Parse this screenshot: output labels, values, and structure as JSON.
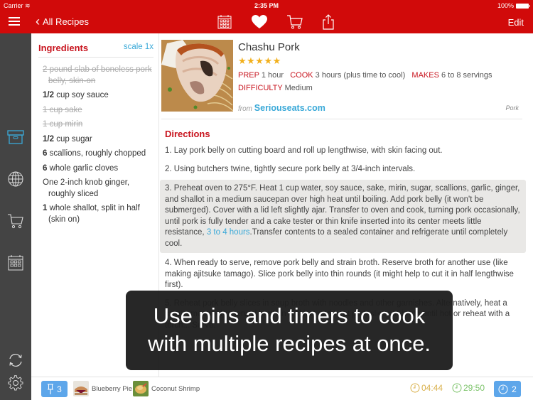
{
  "status_bar": {
    "carrier": "Carrier",
    "time": "2:35 PM",
    "battery": "100%"
  },
  "nav": {
    "back_label": "All Recipes",
    "edit_label": "Edit"
  },
  "ingredients": {
    "title": "Ingredients",
    "scale_label": "scale 1x",
    "items": [
      {
        "qty": "2",
        "text": " pound slab of boneless pork belly, skin-on",
        "done": true
      },
      {
        "qty": "1/2",
        "text": " cup soy sauce",
        "done": false
      },
      {
        "qty": "1",
        "text": " cup sake",
        "done": true
      },
      {
        "qty": "1",
        "text": " cup mirin",
        "done": true
      },
      {
        "qty": "1/2",
        "text": " cup sugar",
        "done": false
      },
      {
        "qty": "6",
        "text": " scallions, roughly chopped",
        "done": false
      },
      {
        "qty": "6",
        "text": " whole garlic cloves",
        "done": false
      },
      {
        "qty": "",
        "text": "One 2-inch knob ginger, roughly sliced",
        "done": false
      },
      {
        "qty": "1",
        "text": " whole shallot, split in half (skin on)",
        "done": false
      }
    ]
  },
  "recipe": {
    "title": "Chashu Pork",
    "rating": 5,
    "stars": "★★★★★",
    "prep_label": "PREP",
    "prep_value": "1 hour",
    "cook_label": "COOK",
    "cook_value": "3 hours (plus time to cool)",
    "makes_label": "MAKES",
    "makes_value": "6 to 8 servings",
    "difficulty_label": "DIFFICULTY",
    "difficulty_value": "Medium",
    "from_label": "from",
    "source": "Seriouseats.com",
    "category": "Pork"
  },
  "directions": {
    "title": "Directions",
    "steps": [
      {
        "text": "1. Lay pork belly on cutting board and roll up lengthwise, with skin facing out."
      },
      {
        "text": "2. Using butchers twine, tightly secure pork belly at 3/4-inch intervals."
      },
      {
        "pre": "3. Preheat oven to 275°F. Heat 1 cup water, soy sauce, sake, mirin, sugar, scallions, garlic, ginger, and shallot in a medium saucepan over high heat until boiling. Add pork belly (it won't be submerged). Cover with a lid left slightly ajar. Transfer to oven and cook, turning pork occasionally, until pork is fully tender and a cake tester or thin knife inserted into its center meets little resistance, ",
        "timer": "3 to 4 hours",
        "post": ".Transfer contents to a sealed container and refrigerate until completely cool."
      },
      {
        "text": "4. When ready to serve, remove pork belly and strain broth. Reserve broth for another use (like making ajitsuke tamago). Slice pork belly into thin rounds (it might help to cut it in half lengthwise first)."
      },
      {
        "text": "5. Reheat pork belly slices in soup broth with noodles and other garnishes. Alternatively, heat a small amount of reserved broth in a skillet and heat pork slices in broth until hot or reheat with a torch... Serve."
      }
    ]
  },
  "overlay": {
    "line1": "Use pins and timers to cook",
    "line2": "with multiple recipes at once."
  },
  "bottom_bar": {
    "pin_count": "3",
    "pinned": [
      {
        "name": "Blueberry Pie"
      },
      {
        "name": "Coconut Shrimp"
      }
    ],
    "timers": [
      {
        "value": "04:44",
        "color": "#d9b04a"
      },
      {
        "value": "29:50",
        "color": "#7cc36a"
      }
    ],
    "timer_count": "2"
  },
  "colors": {
    "brand": "#d10a0a",
    "accent": "#3aa9d8",
    "label_red": "#c8141e",
    "button_blue": "#5da6ea"
  }
}
